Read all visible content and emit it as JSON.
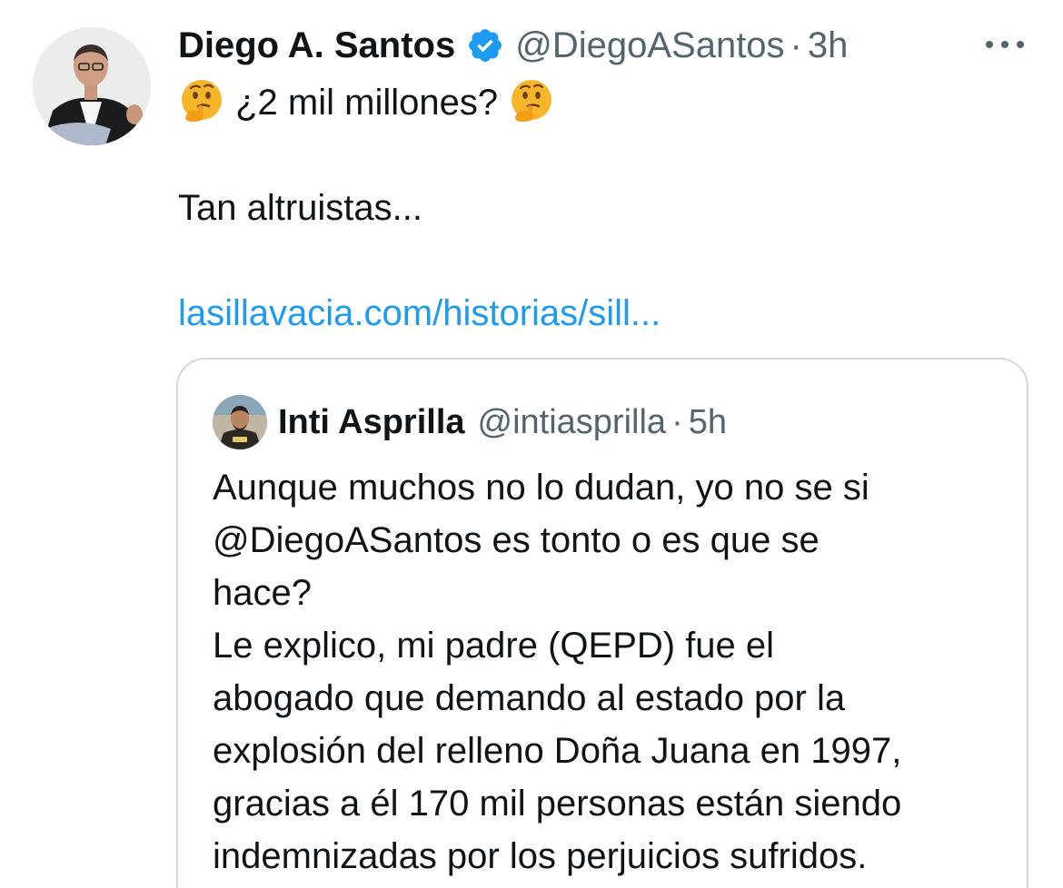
{
  "tweet": {
    "author_name": "Diego A. Santos",
    "handle": "@DiegoASantos",
    "separator": "·",
    "time": "3h",
    "icons": {
      "verified": "verified-badge-icon",
      "more": "more-options-icon",
      "emoji": "thinking-face-emoji"
    },
    "text_line1": "¿2 mil millones?",
    "text_line2": "Tan altruistas...",
    "link": "lasillavacia.com/historias/sill..."
  },
  "quote": {
    "author_name": "Inti Asprilla",
    "handle": "@intiasprilla",
    "separator": "·",
    "time": "5h",
    "lines": [
      "Aunque muchos no lo dudan, yo no se si",
      "@DiegoASantos es tonto o es que se",
      "hace?",
      "Le explico, mi padre (QEPD) fue  el",
      "abogado que demando al estado por la",
      "explosión del relleno Doña Juana en 1997,",
      "gracias a él 170 mil personas están siendo",
      "indemnizadas por los perjuicios sufridos."
    ]
  },
  "colors": {
    "text": "#0f1419",
    "secondary": "#536471",
    "link": "#1d9bf0",
    "verified": "#1d9bf0",
    "border": "#cfd9de"
  }
}
